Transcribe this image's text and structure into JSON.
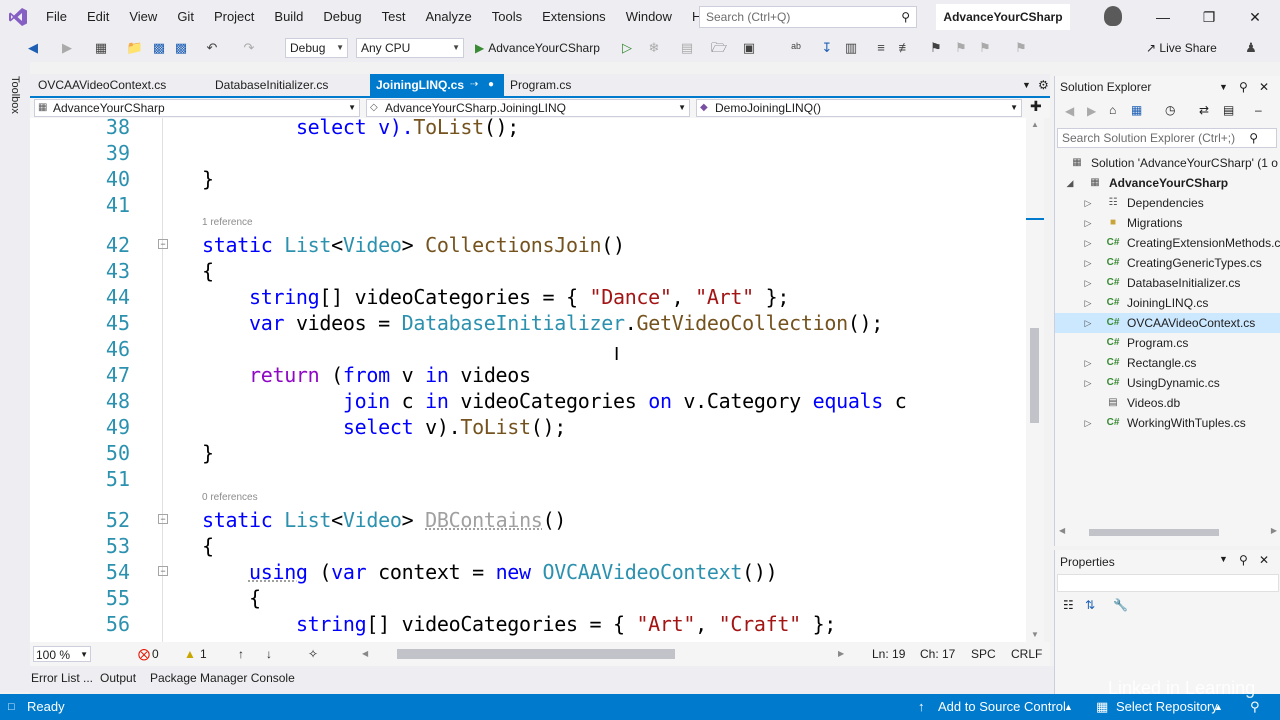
{
  "menu": [
    "File",
    "Edit",
    "View",
    "Git",
    "Project",
    "Build",
    "Debug",
    "Test",
    "Analyze",
    "Tools",
    "Extensions",
    "Window",
    "Help"
  ],
  "search": {
    "placeholder": "Search (Ctrl+Q)"
  },
  "solution_name": "AdvanceYourCSharp",
  "toolbar": {
    "config": "Debug",
    "platform": "Any CPU",
    "run_target": "AdvanceYourCSharp",
    "live_share": "Live Share"
  },
  "toolbox_label": "Toolbox",
  "tabs": [
    {
      "label": "OVCAAVideoContext.cs",
      "active": false
    },
    {
      "label": "DatabaseInitializer.cs",
      "active": false
    },
    {
      "label": "JoiningLINQ.cs",
      "active": true
    },
    {
      "label": "Program.cs",
      "active": false
    }
  ],
  "navbar": {
    "project": "AdvanceYourCSharp",
    "type": "AdvanceYourCSharp.JoiningLINQ",
    "member": "DemoJoiningLINQ()"
  },
  "editor": {
    "line_numbers": [
      "38",
      "39",
      "40",
      "41",
      "42",
      "43",
      "44",
      "45",
      "46",
      "47",
      "48",
      "49",
      "50",
      "51",
      "52",
      "53",
      "54",
      "55",
      "56"
    ],
    "references": [
      "1 reference",
      "0 references"
    ],
    "lines": {
      "l38_a": "select v).",
      "l38_b": "ToList",
      "l38_c": "();",
      "l40": "}",
      "l42_kw": "static",
      "l42_ty1": "List",
      "l42_lt": "<",
      "l42_ty2": "Video",
      "l42_gt": ">",
      "l42_mt": "CollectionsJoin",
      "l42_p": "()",
      "l43": "{",
      "l44_kw": "string",
      "l44_a": "[] videoCategories = { ",
      "l44_s1": "\"Dance\"",
      "l44_c": ", ",
      "l44_s2": "\"Art\"",
      "l44_e": " };",
      "l45_kw": "var",
      "l45_a": " videos = ",
      "l45_ty": "DatabaseInitializer",
      "l45_d": ".",
      "l45_mt": "GetVideoCollection",
      "l45_e": "();",
      "l47_kw": "return",
      "l47_a": " (",
      "l47_k2": "from",
      "l47_b": " v ",
      "l47_k3": "in",
      "l47_c": " videos",
      "l48_k1": "join",
      "l48_a": " c ",
      "l48_k2": "in",
      "l48_b": " videoCategories ",
      "l48_k3": "on",
      "l48_c": " v.Category ",
      "l48_k4": "equals",
      "l48_d": " c",
      "l49_k": "select",
      "l49_a": " v).",
      "l49_mt": "ToList",
      "l49_e": "();",
      "l50": "}",
      "l52_kw": "static",
      "l52_ty1": "List",
      "l52_lt": "<",
      "l52_ty2": "Video",
      "l52_gt": ">",
      "l52_mt": "DBContains",
      "l52_p": "()",
      "l53": "{",
      "l54_kw": "using",
      "l54_a": " (",
      "l54_k2": "var",
      "l54_b": " context = ",
      "l54_k3": "new",
      "l54_ty": " OVCAAVideoContext",
      "l54_e": "())",
      "l55": "{",
      "l56_kw": "string",
      "l56_a": "[] videoCategories = { ",
      "l56_s1": "\"Art\"",
      "l56_c": ", ",
      "l56_s2": "\"Craft\"",
      "l56_e": " };"
    }
  },
  "editor_status": {
    "zoom": "100 %",
    "errors": "0",
    "warnings": "1",
    "line": "Ln: 19",
    "col": "Ch: 17",
    "spc": "SPC",
    "eol": "CRLF"
  },
  "bottom_tabs": [
    "Error List ...",
    "Output",
    "Package Manager Console"
  ],
  "statusbar": {
    "ready": "Ready",
    "source_control": "Add to Source Control",
    "repository": "Select Repository"
  },
  "solution_explorer": {
    "title": "Solution Explorer",
    "search_placeholder": "Search Solution Explorer (Ctrl+;)",
    "items": [
      {
        "label": "Solution 'AdvanceYourCSharp' (1 o",
        "icon": "solution-icon"
      },
      {
        "label": "AdvanceYourCSharp",
        "icon": "csproj-icon"
      },
      {
        "label": "Dependencies",
        "icon": "dependencies-icon"
      },
      {
        "label": "Migrations",
        "icon": "folder-icon"
      },
      {
        "label": "CreatingExtensionMethods.c",
        "icon": "csharp-file-icon"
      },
      {
        "label": "CreatingGenericTypes.cs",
        "icon": "csharp-file-icon"
      },
      {
        "label": "DatabaseInitializer.cs",
        "icon": "csharp-file-icon"
      },
      {
        "label": "JoiningLINQ.cs",
        "icon": "csharp-file-icon"
      },
      {
        "label": "OVCAAVideoContext.cs",
        "icon": "csharp-file-icon",
        "selected": true
      },
      {
        "label": "Program.cs",
        "icon": "csharp-file-icon"
      },
      {
        "label": "Rectangle.cs",
        "icon": "csharp-file-icon"
      },
      {
        "label": "UsingDynamic.cs",
        "icon": "csharp-file-icon"
      },
      {
        "label": "Videos.db",
        "icon": "database-file-icon"
      },
      {
        "label": "WorkingWithTuples.cs",
        "icon": "csharp-file-icon"
      }
    ]
  },
  "properties": {
    "title": "Properties"
  },
  "watermark": "Linked in Learning",
  "colors": {
    "accent": "#007acc",
    "keyword": "#0000ff",
    "type": "#2b91af",
    "method": "#74531f",
    "string": "#a31515",
    "control": "#8f08c4"
  }
}
